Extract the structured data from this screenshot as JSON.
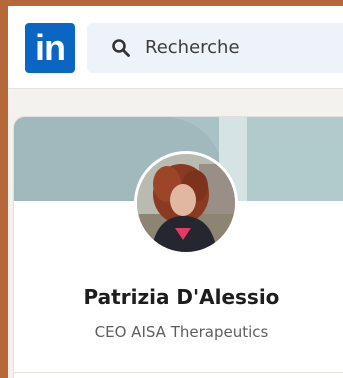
{
  "header": {
    "logo_text": "in",
    "search": {
      "placeholder": "Recherche",
      "icon": "search-icon"
    }
  },
  "profile": {
    "name": "Patrizia D'Alessio",
    "headline": "CEO AISA Therapeutics"
  },
  "colors": {
    "brand": "#0a66c2",
    "search_bg": "#edf3f8",
    "page_bg": "#f4f2ee",
    "cover": "#a8c2c5"
  }
}
